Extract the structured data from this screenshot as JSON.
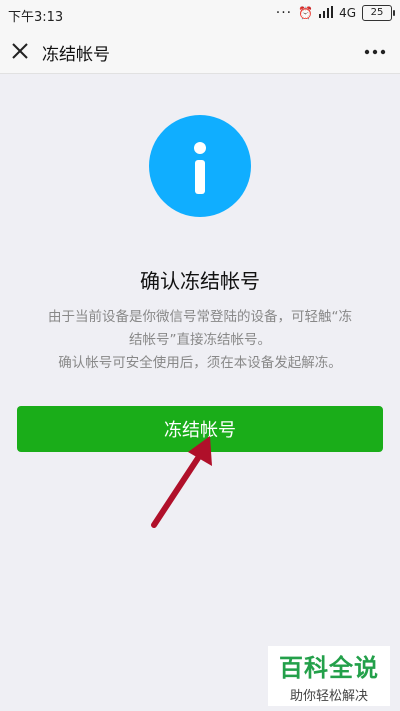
{
  "status_bar": {
    "time": "下午3:13",
    "indicators": "... ⏰ ▮▮▮",
    "network": "4G",
    "battery": "25"
  },
  "header": {
    "title": "冻结帐号",
    "close_icon": "close-icon",
    "more_icon": "more-icon"
  },
  "content": {
    "icon": "info-icon",
    "icon_color": "#10aeff",
    "title": "确认冻结帐号",
    "description_lines": [
      "由于当前设备是你微信号常登陆的设备，可轻触“冻",
      "结帐号”直接冻结帐号。",
      "确认帐号可安全使用后，须在本设备发起解冻。"
    ]
  },
  "button": {
    "label": "冻结帐号",
    "color": "#1aad19"
  },
  "watermark": {
    "main": "百科全说",
    "sub": "助你轻松解决"
  },
  "annotation": {
    "arrow_color": "#b0102a"
  }
}
